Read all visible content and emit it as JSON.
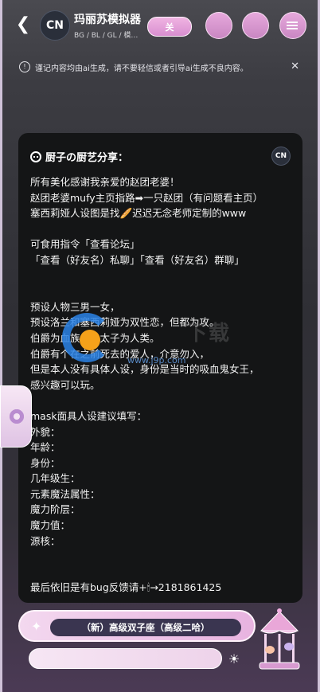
{
  "header": {
    "avatar_text": "CN",
    "title": "玛丽苏模拟器",
    "subtitle": "BG / BL / GL / 模…",
    "follow_label": "关"
  },
  "notice": {
    "text": "谨记内容均由ai生成，请不要轻信或者引导ai生成不良内容。",
    "close": "✕"
  },
  "card": {
    "header": "厨子の厨艺分享：",
    "avatar_text": "CN",
    "body": "所有美化感谢我亲爱的赵团老婆！\n赵团老婆mufy主页指路➡一只赵团（有问题看主页）\n塞西莉娅人设图是找🥖迟迟无念老师定制的www\n\n可食用指令「查看论坛」\n「查看（好友名）私聊」「查看（好友名）群聊」\n\n\n预设人物三男一女，\n预设洛兰和塞西莉娅为双性恋，但都为攻。\n伯爵为血族，皇太子为人类。\n伯爵有个在之前死去的爱人，介意勿入，\n但是本人没有具体人设，身份是当时的吸血鬼女王，\n感兴趣可以玩。\n\nmask面具人设建议填写：\n外貌：\n年龄：\n身份：\n几年级生：\n元素魔法属性：\n魔力阶层：\n魔力值：\n源核：\n\n\n最后依旧是有bug反馈请+🕯→2181861425"
  },
  "watermark": {
    "site": "www.j9p.com",
    "brand": "下载"
  },
  "bottom": {
    "model_label": "（新）高级双子座（高级二哈）",
    "input_placeholder": ""
  }
}
